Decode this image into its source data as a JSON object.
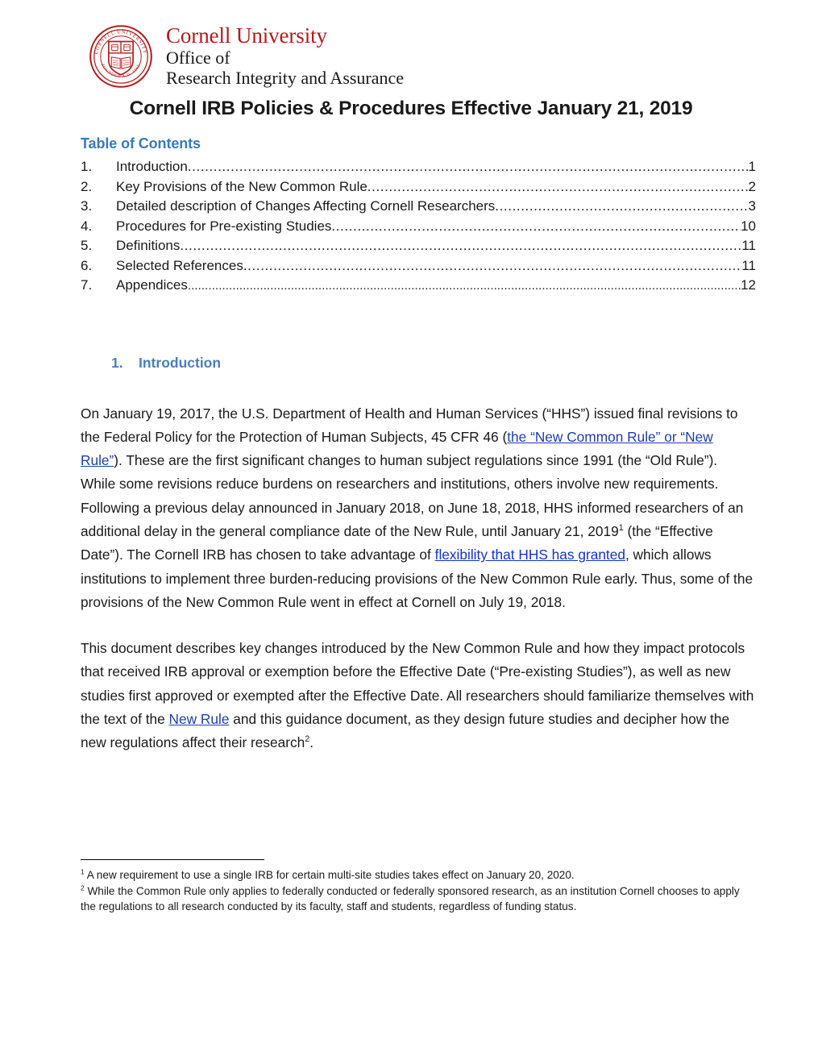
{
  "letterhead": {
    "seal_icon": "cornell-seal-icon",
    "seal_top_text": "CORNELL UNIVERSITY",
    "seal_bottom_text": "FOUNDED A.D. 1865",
    "university": "Cornell University",
    "office_line1": "Office of",
    "office_line2": "Research Integrity and Assurance",
    "brand_red": "#b31b1b"
  },
  "document": {
    "title": "Cornell IRB Policies & Procedures Effective January 21, 2019"
  },
  "toc": {
    "heading": "Table of Contents",
    "heading_color": "#3a7abd",
    "entries": [
      {
        "num": "1.",
        "label": "Introduction",
        "page": "1"
      },
      {
        "num": "2.",
        "label": "Key Provisions of the New Common Rule",
        "page": "2"
      },
      {
        "num": "3.",
        "label": "Detailed description of Changes Affecting Cornell Researchers ",
        "page": "3"
      },
      {
        "num": "4.",
        "label": "Procedures for Pre-existing Studies ",
        "page": "10"
      },
      {
        "num": "5.",
        "label": "Definitions ",
        "page": "11"
      },
      {
        "num": "6.",
        "label": "Selected References",
        "page": "11"
      },
      {
        "num": "7.",
        "label": "Appendices",
        "page": "12"
      }
    ]
  },
  "section1": {
    "num": "1.",
    "heading": "Introduction",
    "heading_color": "#4a7fbb",
    "paragraph1": {
      "t1": "On January 19, 2017, the U.S. Department of Health and Human Services (“HHS”) issued final revisions to the Federal Policy for the Protection of Human Subjects, 45 CFR 46 (",
      "link1": "the “New Common Rule” or “New Rule”",
      "t2": ").  These are the first significant changes to  human subject regulations since 1991 (the “Old Rule”). While some revisions reduce burdens on researchers and institutions, others involve new requirements.  Following a previous delay announced in January 2018, on June 18, 2018, HHS informed researchers of an additional delay in the general compliance date of the New Rule, until January 21, 2019",
      "sup1": "1",
      "t3": " (the “Effective Date”). The Cornell IRB has chosen to take advantage of ",
      "link2": "flexibility that HHS has granted",
      "t4": ", which allows institutions to implement three burden-reducing provisions of the New Common Rule early. Thus, some of the provisions of the New Common Rule went in effect at Cornell on July 19, 2018."
    },
    "paragraph2": {
      "t1": "This document describes key changes introduced by the New Common Rule and how they impact protocols that received IRB approval or exemption before the Effective Date (“Pre-existing Studies”), as well as new studies first approved or exempted after the Effective Date.  All researchers should familiarize themselves with the text of the ",
      "link1": "New Rule",
      "t2": " and this guidance document, as they design future studies and decipher how the new regulations affect their research",
      "sup1": "2",
      "t3": "."
    }
  },
  "footnotes": [
    {
      "marker": "1",
      "text": " A new requirement to use a single IRB for certain multi-site studies takes effect on January 20, 2020."
    },
    {
      "marker": "2",
      "text": " While the Common Rule only applies to federally conducted or federally sponsored research, as an institution Cornell chooses to apply the regulations to all research conducted by its faculty, staff and students, regardless of funding status."
    }
  ],
  "link_color": "#1432c8"
}
